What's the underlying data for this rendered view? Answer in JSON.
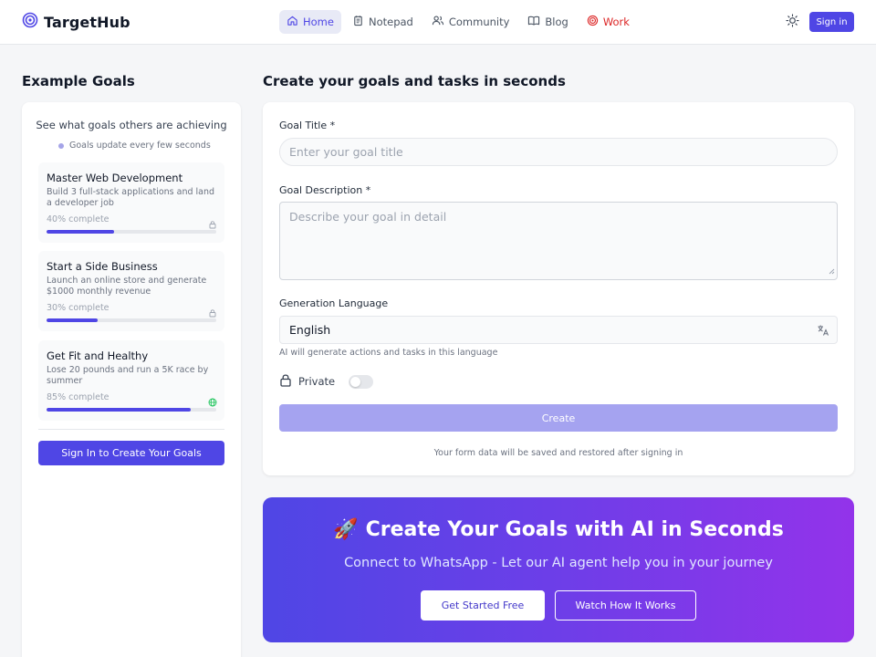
{
  "header": {
    "brand": "TargetHub",
    "nav": [
      {
        "label": "Home",
        "icon": "home-icon",
        "active": true
      },
      {
        "label": "Notepad",
        "icon": "notepad-icon"
      },
      {
        "label": "Community",
        "icon": "users-icon"
      },
      {
        "label": "Blog",
        "icon": "book-icon"
      },
      {
        "label": "Work",
        "icon": "target-icon"
      }
    ],
    "signin": "Sign in"
  },
  "examples": {
    "title": "Example Goals",
    "subtitle": "See what goals others are achieving",
    "live_note": "Goals update every few seconds",
    "goals": [
      {
        "title": "Master Web Development",
        "description": "Build 3 full-stack applications and land a developer job",
        "progress_label": "40% complete",
        "progress": 40,
        "visibility_icon": "lock-icon"
      },
      {
        "title": "Start a Side Business",
        "description": "Launch an online store and generate $1000 monthly revenue",
        "progress_label": "30% complete",
        "progress": 30,
        "visibility_icon": "lock-icon"
      },
      {
        "title": "Get Fit and Healthy",
        "description": "Lose 20 pounds and run a 5K race by summer",
        "progress_label": "85% complete",
        "progress": 85,
        "visibility_icon": "globe-icon"
      }
    ],
    "cta": "Sign In to Create Your Goals"
  },
  "form": {
    "title": "Create your goals and tasks in seconds",
    "goal_title_label": "Goal Title *",
    "goal_title_placeholder": "Enter your goal title",
    "goal_desc_label": "Goal Description *",
    "goal_desc_placeholder": "Describe your goal in detail",
    "lang_label": "Generation Language",
    "lang_value": "English",
    "lang_help": "AI will generate actions and tasks in this language",
    "private_label": "Private",
    "private_on": false,
    "create_button": "Create",
    "save_note": "Your form data will be saved and restored after signing in"
  },
  "banner": {
    "emoji": "🚀",
    "title": "Create Your Goals with AI in Seconds",
    "subtitle": "Connect to WhatsApp - Let our AI agent help you in your journey",
    "primary": "Get Started Free",
    "secondary": "Watch How It Works"
  },
  "colors": {
    "accent": "#4f46e5",
    "work": "#dc2626",
    "create_disabled": "#a5a3f0",
    "public": "#22c55e"
  }
}
